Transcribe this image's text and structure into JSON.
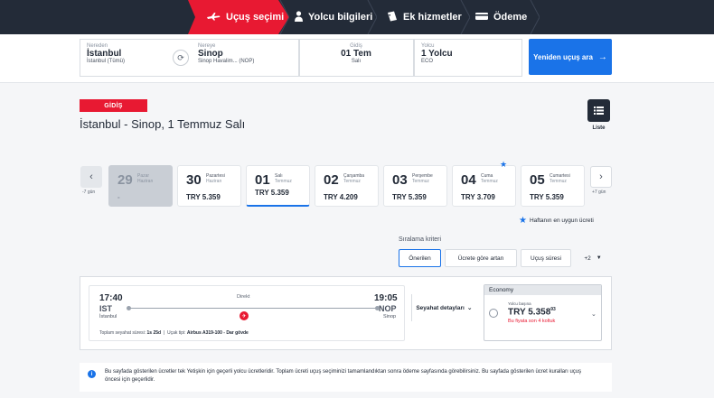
{
  "steps": [
    {
      "label": "Uçuş seçimi",
      "icon": "plane-icon",
      "active": true
    },
    {
      "label": "Yolcu bilgileri",
      "icon": "person-icon",
      "active": false
    },
    {
      "label": "Ek hizmetler",
      "icon": "ticket-icon",
      "active": false
    },
    {
      "label": "Ödeme",
      "icon": "card-icon",
      "active": false
    }
  ],
  "search": {
    "from": {
      "label": "Nereden",
      "city": "İstanbul",
      "airport": "İstanbul (Tümü)"
    },
    "to": {
      "label": "Nereye",
      "city": "Sinop",
      "airport": "Sinop Havalim... (NOP)"
    },
    "date": {
      "label": "Gidiş",
      "value": "01 Tem",
      "weekday": "Salı"
    },
    "passenger": {
      "label": "Yolcu",
      "value": "1 Yolcu",
      "cabin": "ECO"
    },
    "button_label": "Yeniden uçuş ara"
  },
  "heading": {
    "badge": "GİDİŞ",
    "route": "İstanbul - Sinop, 1 Temmuz Salı",
    "list_label": "Liste"
  },
  "date_nav": {
    "prev_label": "-7 gün",
    "next_label": "+7 gün"
  },
  "dates": [
    {
      "day": "29",
      "weekday": "Pazar",
      "month": "Haziran",
      "price": "-",
      "disabled": true,
      "selected": false,
      "best": false
    },
    {
      "day": "30",
      "weekday": "Pazartesi",
      "month": "Haziran",
      "price": "TRY 5.359",
      "disabled": false,
      "selected": false,
      "best": false
    },
    {
      "day": "01",
      "weekday": "Salı",
      "month": "Temmuz",
      "price": "TRY 5.359",
      "disabled": false,
      "selected": true,
      "best": false
    },
    {
      "day": "02",
      "weekday": "Çarşamba",
      "month": "Temmuz",
      "price": "TRY 4.209",
      "disabled": false,
      "selected": false,
      "best": false
    },
    {
      "day": "03",
      "weekday": "Perşembe",
      "month": "Temmuz",
      "price": "TRY 5.359",
      "disabled": false,
      "selected": false,
      "best": false
    },
    {
      "day": "04",
      "weekday": "Cuma",
      "month": "Temmuz",
      "price": "TRY 3.709",
      "disabled": false,
      "selected": false,
      "best": true
    },
    {
      "day": "05",
      "weekday": "Cumartesi",
      "month": "Temmuz",
      "price": "TRY 5.359",
      "disabled": false,
      "selected": false,
      "best": false
    }
  ],
  "best_week_label": "Haftanın en uygun ücreti",
  "sorting": {
    "title": "Sıralama kriteri",
    "options": [
      "Önerilen",
      "Ücrete göre artan",
      "Uçuş süresi",
      "+2"
    ]
  },
  "flight": {
    "dep_time": "17:40",
    "dep_code": "IST",
    "dep_city": "İstanbul",
    "arr_time": "19:05",
    "arr_code": "NOP",
    "arr_city": "Sinop",
    "type": "Direkt",
    "duration_label": "Toplam seyahat süresi:",
    "duration": "1s 25d",
    "aircraft_label": "Uçak tipi:",
    "aircraft": "Airbus A319-100 - Dar gövde",
    "details_label": "Seyahat detayları"
  },
  "fare": {
    "cabin": "Economy",
    "per_label": "Yolcu başına",
    "price": "TRY 5.358",
    "price_cents": "93",
    "warning": "Bu fiyata son 4 koltuk"
  },
  "info_text": "Bu sayfada gösterilen ücretler tek Yetişkin için geçerli yolcu ücretleridir. Toplam ücreti uçuş seçiminizi tamamlandıktan sonra ödeme sayfasında görebilirsiniz. Bu sayfada gösterilen ücret kuralları uçuş öncesi için geçerlidir.",
  "colors": {
    "brand_red": "#e81932",
    "dark": "#232b38",
    "accent_blue": "#1a73e8"
  }
}
